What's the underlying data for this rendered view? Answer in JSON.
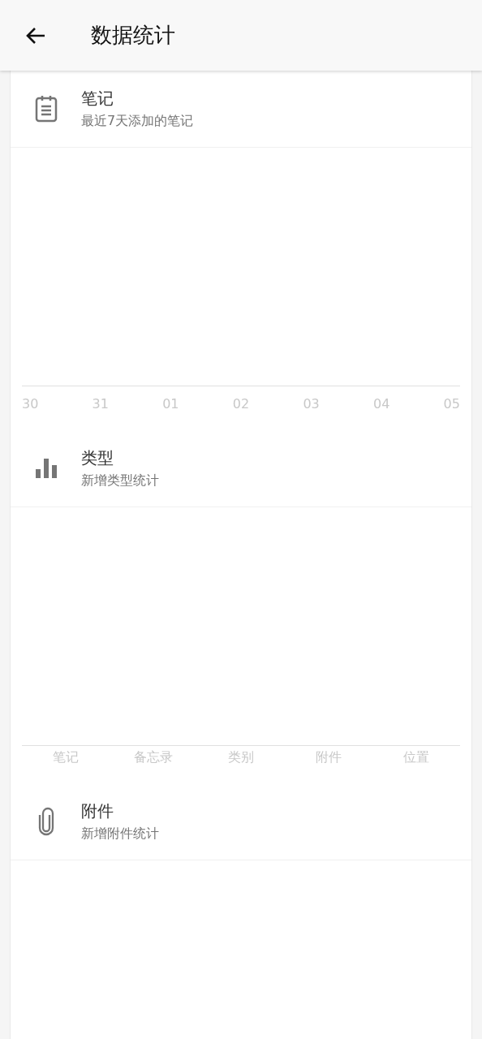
{
  "app_bar": {
    "title": "数据统计"
  },
  "cards": [
    {
      "kind": "notes",
      "title": "笔记",
      "subtitle": "最近7天添加的笔记",
      "chart": {
        "kind": "dates",
        "axis_labels": [
          "30",
          "31",
          "01",
          "02",
          "03",
          "04",
          "05"
        ]
      }
    },
    {
      "kind": "types",
      "title": "类型",
      "subtitle": "新增类型统计",
      "chart": {
        "kind": "categories",
        "axis_labels": [
          "笔记",
          "备忘录",
          "类别",
          "附件",
          "位置"
        ]
      }
    },
    {
      "kind": "attachments",
      "title": "附件",
      "subtitle": "新增附件统计"
    }
  ]
}
